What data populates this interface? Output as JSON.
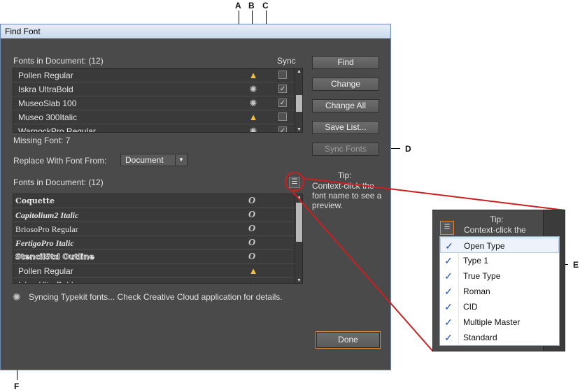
{
  "callouts": {
    "a": "A",
    "b": "B",
    "c": "C",
    "d": "D",
    "e": "E",
    "f": "F"
  },
  "dialog": {
    "title": "Find Font",
    "fonts_header": "Fonts in Document: (12)",
    "sync_header": "Sync",
    "fonts_list": [
      {
        "name": "Pollen Regular",
        "status": "warning",
        "sync": "unchecked"
      },
      {
        "name": "Iskra UltraBold",
        "status": "syncing",
        "sync": "checked"
      },
      {
        "name": "MuseoSlab 100",
        "status": "syncing",
        "sync": "checked"
      },
      {
        "name": "Museo 300Italic",
        "status": "warning",
        "sync": "unchecked"
      },
      {
        "name": "WarnockPro Regular",
        "status": "syncing",
        "sync": "checked"
      }
    ],
    "missing_font": "Missing Font: 7",
    "replace_label": "Replace With Font From:",
    "replace_value": "Document",
    "fonts_header2": "Fonts in Document: (12)",
    "tip_title": "Tip:",
    "tip_text": "Context-click the font name to see a preview.",
    "replace_list": [
      {
        "name": "Coquette",
        "type": "opentype"
      },
      {
        "name": "Capitolium2 Italic",
        "type": "opentype"
      },
      {
        "name": "BriosoPro Regular",
        "type": "opentype"
      },
      {
        "name": "FertigoPro Italic",
        "type": "opentype"
      },
      {
        "name": "StencilStd Outline",
        "type": "opentype"
      },
      {
        "name": "Pollen Regular",
        "type": "warning"
      },
      {
        "name": "Iskra UltraBold",
        "type": "warning"
      }
    ],
    "sync_status": "Syncing Typekit fonts... Check Creative Cloud application for details.",
    "buttons": {
      "find": "Find",
      "change": "Change",
      "change_all": "Change All",
      "save_list": "Save List...",
      "sync_fonts": "Sync Fonts",
      "done": "Done"
    }
  },
  "zoom": {
    "tip_title": "Tip:",
    "tip_text": "Context-click the",
    "menu_items": [
      {
        "label": "Open Type",
        "checked": true
      },
      {
        "label": "Type 1",
        "checked": true
      },
      {
        "label": "True Type",
        "checked": true
      },
      {
        "label": "Roman",
        "checked": true
      },
      {
        "label": "CID",
        "checked": true
      },
      {
        "label": "Multiple Master",
        "checked": true
      },
      {
        "label": "Standard",
        "checked": true
      }
    ]
  },
  "colors": {
    "accent": "#e08a3c",
    "callout_red": "#cc1f1f",
    "warning": "#f3c23a",
    "check": "#1d4fb5"
  },
  "icons": {
    "warning": "warning-icon",
    "syncing": "syncing-icon",
    "opentype": "opentype-icon",
    "filter": "filter-list-icon",
    "check": "checkmark-icon"
  }
}
